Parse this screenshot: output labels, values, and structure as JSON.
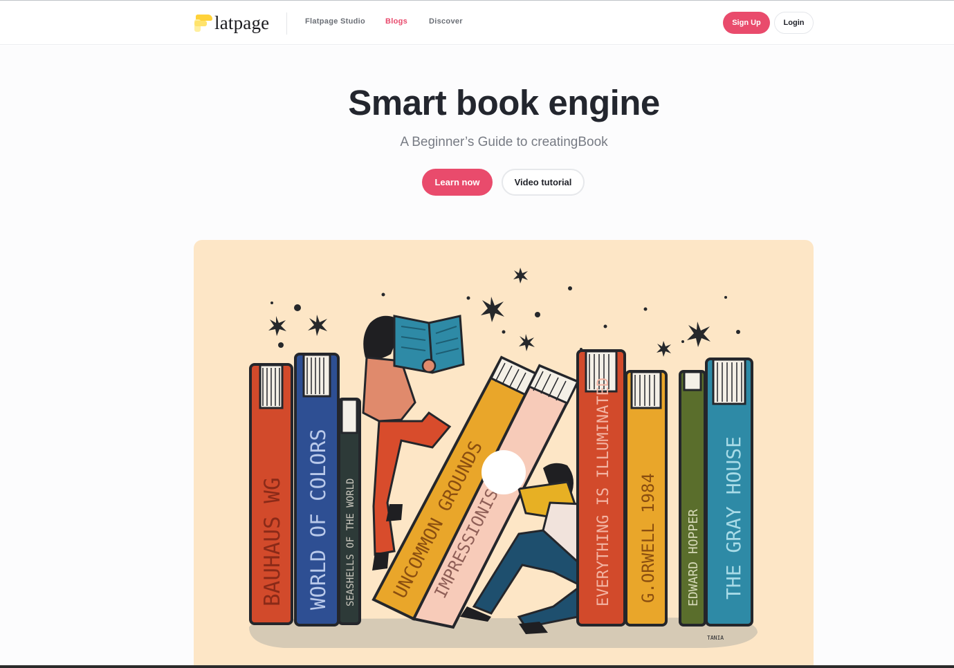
{
  "header": {
    "logo_text": "latpage",
    "nav": [
      {
        "label": "Flatpage Studio"
      },
      {
        "label": "Blogs",
        "active": true
      },
      {
        "label": "Discover"
      }
    ],
    "signup_label": "Sign Up",
    "login_label": "Login"
  },
  "hero": {
    "title": "Smart book engine",
    "subtitle": "A Beginner’s Guide to creatingBook",
    "primary_button": "Learn now",
    "secondary_button": "Video tutorial"
  },
  "illustration": {
    "book_titles": [
      "BAUHAUS WG",
      "WORLD OF COLORS",
      "SEASHELLS OF THE WORLD",
      "UNCOMMON GROUNDS",
      "IMPRESSIONISM",
      "EVERYTHING IS ILLUMINATED",
      "G.ORWELL 1984",
      "EDWARD HOPPER",
      "THE GRAY HOUSE"
    ],
    "signature": "TANIA"
  },
  "colors": {
    "accent": "#e94b6c",
    "illustration_bg": "#fde6c6",
    "text_dark": "#23262e",
    "text_muted": "#777b84"
  },
  "icons": [
    "logo-mark-icon",
    "play-button-icon",
    "star-icon"
  ]
}
